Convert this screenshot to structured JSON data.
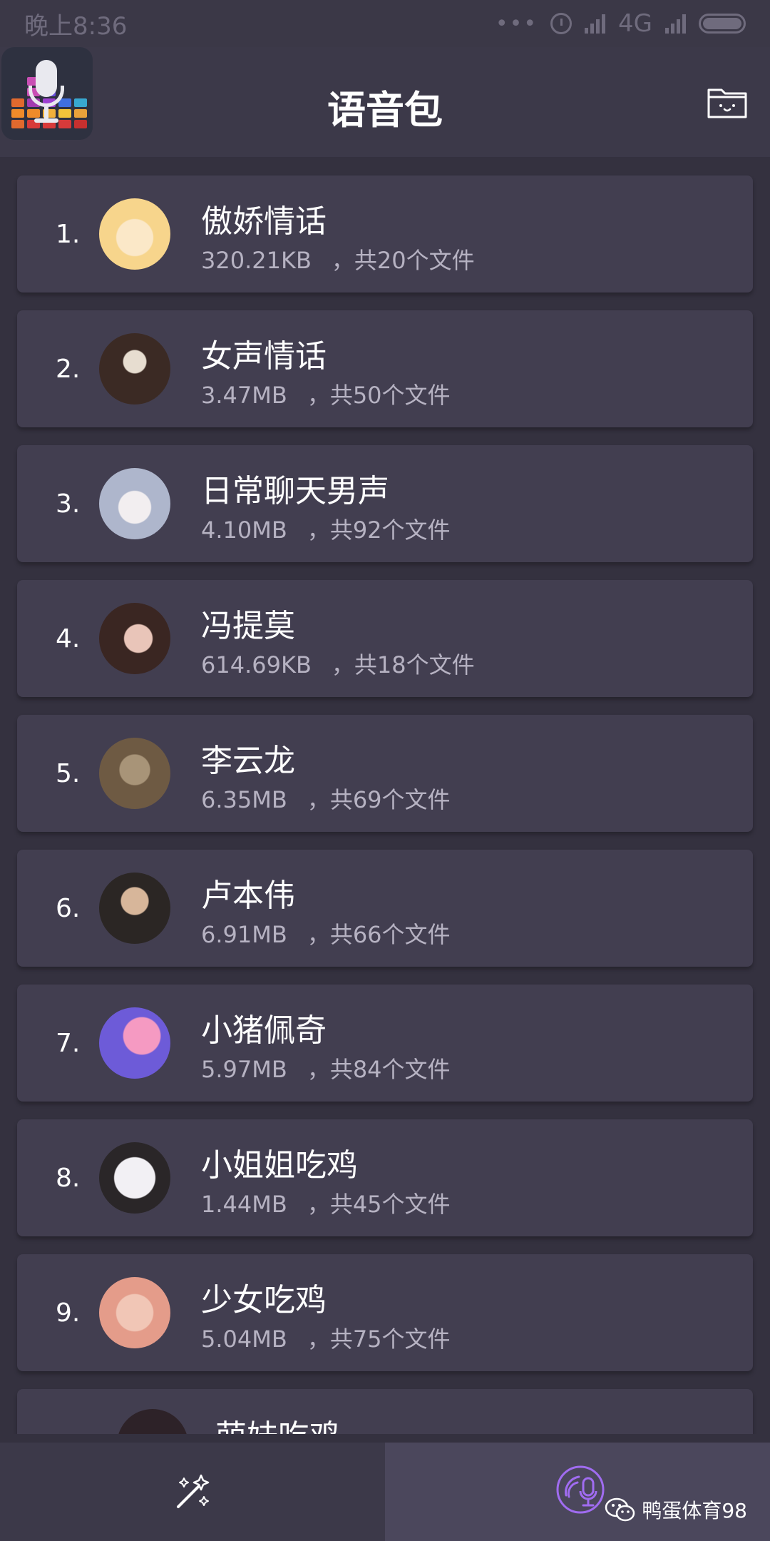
{
  "status_bar": {
    "time": "晚上8:36",
    "network": "4G"
  },
  "header": {
    "title": "语音包"
  },
  "list": [
    {
      "index": "1.",
      "name": "傲娇情话",
      "size": "320.21KB",
      "count": "，共20个文件",
      "avatar_colors": [
        "#f7d58c",
        "#fbe8c8"
      ]
    },
    {
      "index": "2.",
      "name": "女声情话",
      "size": "3.47MB",
      "count": "，共50个文件",
      "avatar_colors": [
        "#3b2a24",
        "#e7ddd0"
      ]
    },
    {
      "index": "3.",
      "name": "日常聊天男声",
      "size": "4.10MB",
      "count": "，共92个文件",
      "avatar_colors": [
        "#aeb6cc",
        "#f2eef0"
      ]
    },
    {
      "index": "4.",
      "name": "冯提莫",
      "size": "614.69KB",
      "count": "，共18个文件",
      "avatar_colors": [
        "#3a2622",
        "#e9c5b9"
      ]
    },
    {
      "index": "5.",
      "name": "李云龙",
      "size": "6.35MB",
      "count": "，共69个文件",
      "avatar_colors": [
        "#6e5a43",
        "#a89478"
      ]
    },
    {
      "index": "6.",
      "name": "卢本伟",
      "size": "6.91MB",
      "count": "，共66个文件",
      "avatar_colors": [
        "#2b2624",
        "#d7b69a"
      ]
    },
    {
      "index": "7.",
      "name": "小猪佩奇",
      "size": "5.97MB",
      "count": "，共84个文件",
      "avatar_colors": [
        "#f59ac2",
        "#6d5bd8"
      ]
    },
    {
      "index": "8.",
      "name": "小姐姐吃鸡",
      "size": "1.44MB",
      "count": "，共45个文件",
      "avatar_colors": [
        "#f2f0f4",
        "#2a2628"
      ]
    },
    {
      "index": "9.",
      "name": "少女吃鸡",
      "size": "5.04MB",
      "count": "，共75个文件",
      "avatar_colors": [
        "#f1c6b6",
        "#e49c8a"
      ]
    },
    {
      "index": "",
      "name": "萌妹吃鸡",
      "size": "",
      "count": "",
      "avatar_colors": [
        "#2d2228",
        "#c98a9a"
      ]
    }
  ],
  "watermark": {
    "text": "鸭蛋体育98"
  },
  "colors": {
    "background": "#34313f",
    "card": "#423e50",
    "appbar": "#3c3949",
    "nav_active": "#4b475c",
    "accent_purple": "#a06cf0"
  },
  "icons": [
    "alarm-icon",
    "signal-icon",
    "battery-icon",
    "folder-icon",
    "magic-wand-icon",
    "voice-pack-icon",
    "wechat-icon"
  ]
}
